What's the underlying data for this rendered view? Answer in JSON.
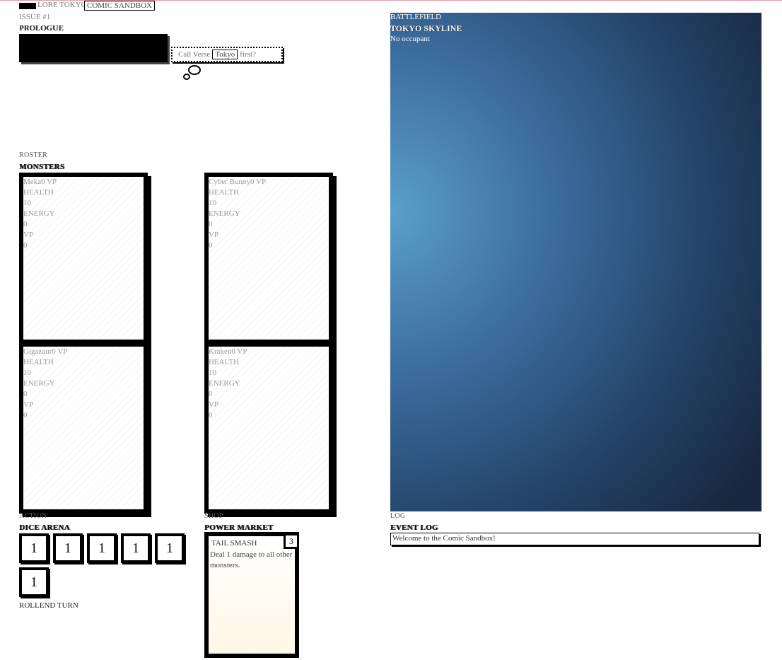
{
  "header": {
    "brand": "LORE TOKYO",
    "brand_box": "COMIC SANDBOX",
    "issue": "ISSUE #1",
    "prologue": "PROLOGUE",
    "bubble_pre": "Call Verse",
    "bubble_highlight": "Tokyo",
    "bubble_post": "first?"
  },
  "roster": {
    "kicker": "ROSTER",
    "heading": "MONSTERS",
    "monsters": [
      {
        "name": "Meka0 VP",
        "health_label": "HEALTH",
        "health": "10",
        "energy_label": "ENERGY",
        "energy": "0",
        "vp_label": "VP",
        "vp": "0"
      },
      {
        "name": "Cyber Bunny0 VP",
        "health_label": "HEALTH",
        "health": "10",
        "energy_label": "ENERGY",
        "energy": "0",
        "vp_label": "VP",
        "vp": "0"
      },
      {
        "name": "Gigazaur0 VP",
        "health_label": "HEALTH",
        "health": "10",
        "energy_label": "ENERGY",
        "energy": "0",
        "vp_label": "VP",
        "vp": "0"
      },
      {
        "name": "Kraken0 VP",
        "health_label": "HEALTH",
        "health": "10",
        "energy_label": "ENERGY",
        "energy": "0",
        "vp_label": "VP",
        "vp": "0"
      }
    ]
  },
  "action": {
    "kicker": "ACTION",
    "heading": "DICE ARENA",
    "dice": [
      "1",
      "1",
      "1",
      "1",
      "1",
      "1"
    ],
    "rollend": "ROLLEND TURN"
  },
  "shop": {
    "kicker": "SHOP",
    "heading": "POWER MARKET",
    "card": {
      "title": "TAIL SMASH",
      "cost": "3",
      "desc": "Deal 1 damage to all other monsters."
    }
  },
  "battlefield": {
    "kicker": "BATTLEFIELD",
    "title": "TOKYO SKYLINE",
    "occupant": "No occupant"
  },
  "log": {
    "kicker": "LOG",
    "heading": "EVENT LOG",
    "entries": [
      "Welcome to the Comic Sandbox!"
    ]
  }
}
